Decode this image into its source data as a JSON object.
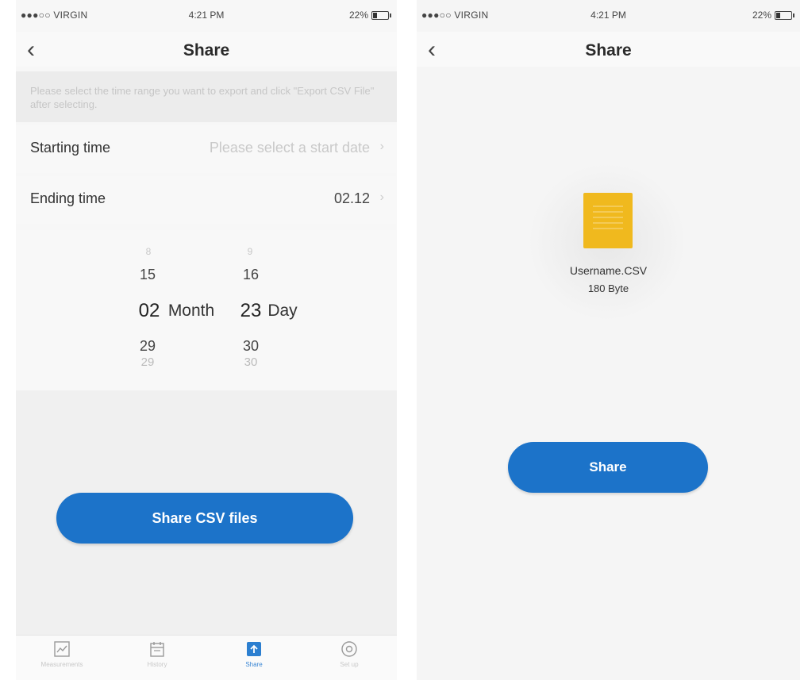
{
  "status": {
    "carrier": "●●●○○ VIRGIN",
    "time": "4:21 PM",
    "battery": "22%"
  },
  "left": {
    "nav": {
      "back_icon": "chevron-left-icon",
      "title": "Share"
    },
    "hint": "Please select the time range you want to export and click \"Export CSV File\" after selecting.",
    "starting_time": {
      "label": "Starting time",
      "placeholder": "Please select a start date"
    },
    "ending_time": {
      "label": "Ending time",
      "value": "02.12"
    },
    "picker": {
      "month": {
        "above2": "8",
        "above1": "15",
        "selected": "02",
        "unit": "Month",
        "below1": "29",
        "below2": "29"
      },
      "day": {
        "above2": "9",
        "above1": "16",
        "selected": "23",
        "unit": "Day",
        "below1": "30",
        "below2": "30"
      }
    },
    "button": "Share CSV files",
    "tabs": [
      {
        "icon": "chart-icon",
        "label": "Measurements"
      },
      {
        "icon": "calendar-icon",
        "label": "History"
      },
      {
        "icon": "share-icon",
        "label": "Share"
      },
      {
        "icon": "settings-icon",
        "label": "Set up"
      }
    ]
  },
  "right": {
    "nav": {
      "back_icon": "chevron-left-icon",
      "title": "Share"
    },
    "file": {
      "icon": "csv-file-icon",
      "color": "#f0b91e",
      "name": "Username.CSV",
      "size": "180 Byte"
    },
    "button": "Share"
  },
  "colors": {
    "accent": "#1c73c9",
    "file": "#f0b91e"
  }
}
